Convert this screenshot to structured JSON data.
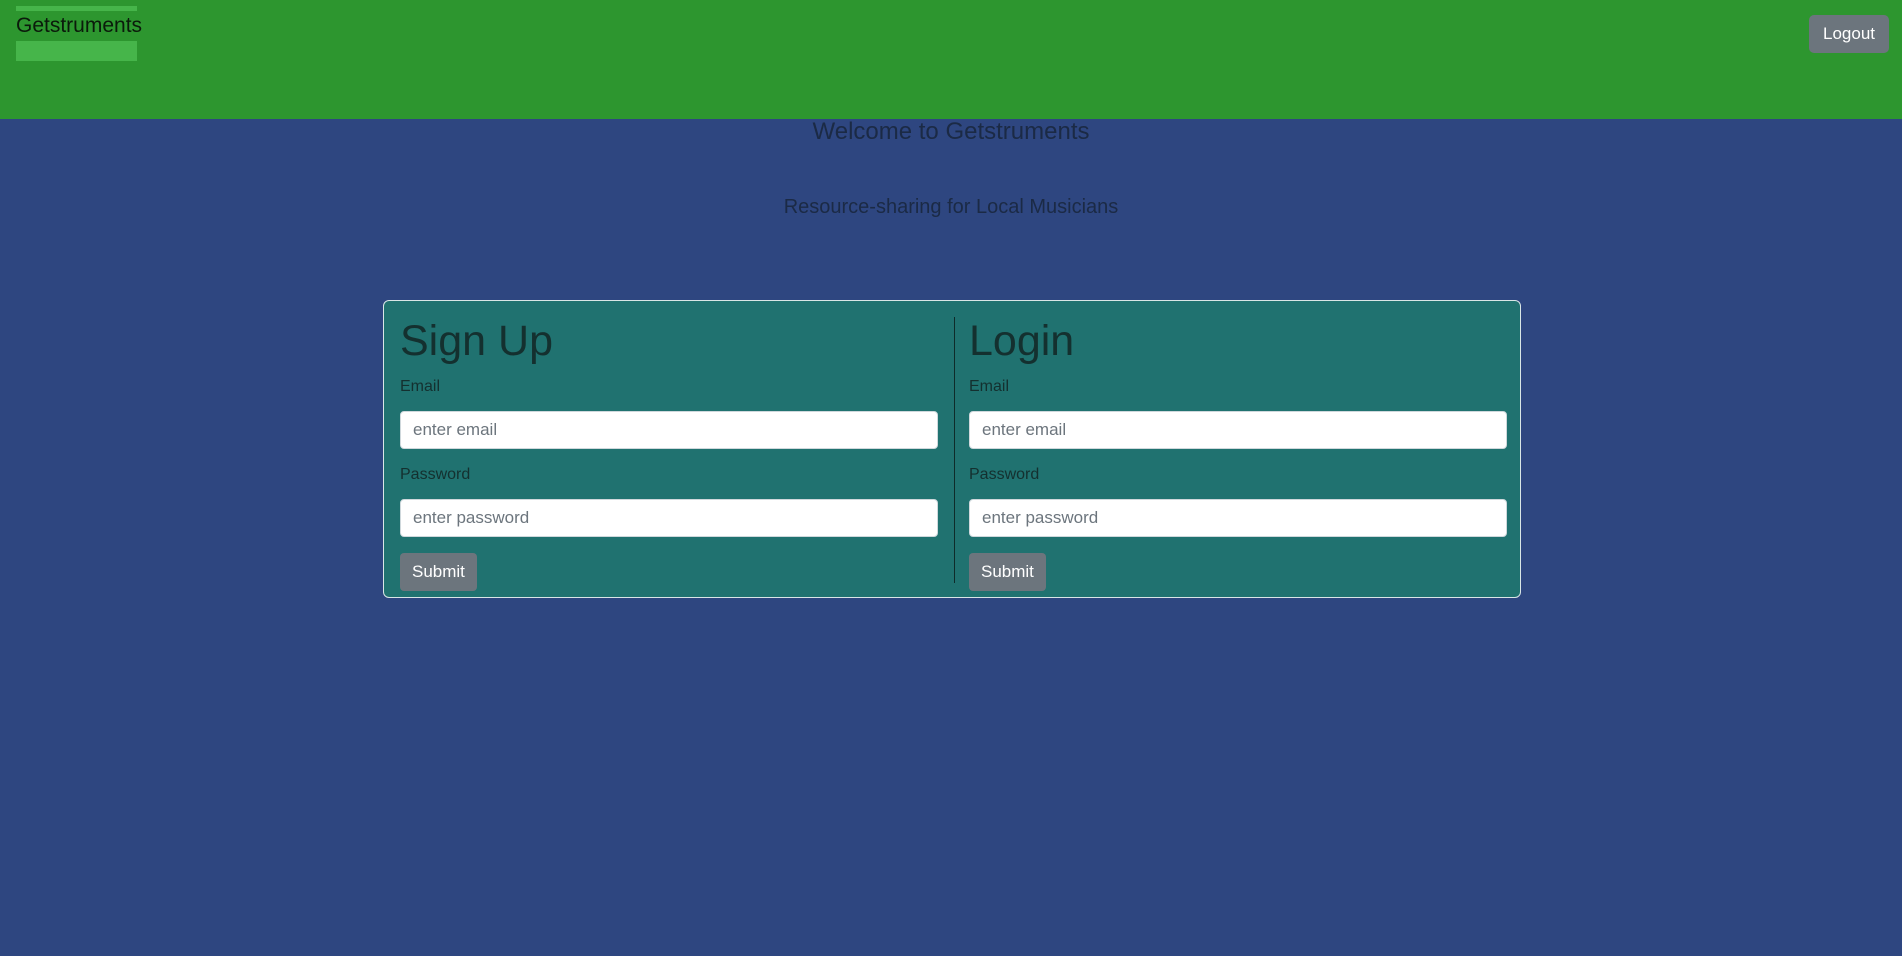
{
  "navbar": {
    "brand": "Getstruments",
    "logout_label": "Logout",
    "color": "#2d962f"
  },
  "hero": {
    "title": "Welcome to Getstruments",
    "tagline": "Resource-sharing for Local Musicians"
  },
  "signup": {
    "title": "Sign Up",
    "email_label": "Email",
    "email_placeholder": "enter email",
    "password_label": "Password",
    "password_placeholder": "enter password",
    "submit_label": "Submit"
  },
  "login": {
    "title": "Login",
    "email_label": "Email",
    "email_placeholder": "enter email",
    "password_label": "Password",
    "password_placeholder": "enter password",
    "submit_label": "Submit"
  },
  "colors": {
    "background": "#2e4680",
    "card": "#207270",
    "button": "#6c757d"
  }
}
